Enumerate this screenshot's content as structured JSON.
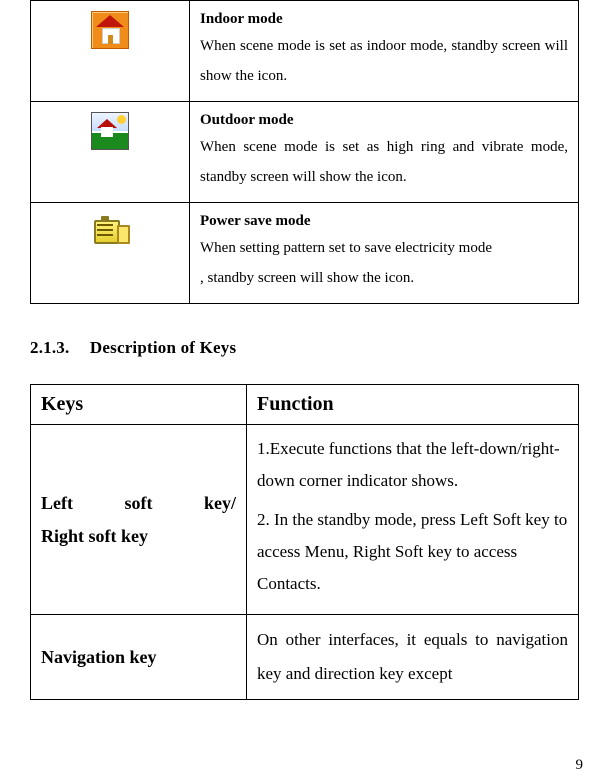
{
  "modes": [
    {
      "title": "Indoor mode",
      "desc": "When scene mode is set as indoor mode, standby screen will show the icon.",
      "icon": "indoor-mode-icon"
    },
    {
      "title": "Outdoor mode",
      "desc": "When scene mode is set as high ring and vibrate mode, standby screen will show the icon.",
      "icon": "outdoor-mode-icon"
    },
    {
      "title": "Power save mode",
      "desc_line1": "When setting pattern set to save electricity mode",
      "desc_line2": ", standby screen will show the icon.",
      "icon": "power-save-icon"
    }
  ],
  "section": {
    "number": "2.1.3.",
    "title": "Description of Keys"
  },
  "keys_table": {
    "header_keys": "Keys",
    "header_function": "Function",
    "rows": [
      {
        "key_line1": "Left soft key/",
        "key_line2": "Right soft key",
        "fn1": "1.Execute functions that the left-down/right-down corner indicator shows.",
        "fn2": "2. In the standby mode, press Left Soft key to access Menu, Right Soft key to access Contacts."
      },
      {
        "key": "Navigation key",
        "fn": "On other interfaces, it equals to navigation key and direction key except"
      }
    ]
  },
  "page_number": "9"
}
